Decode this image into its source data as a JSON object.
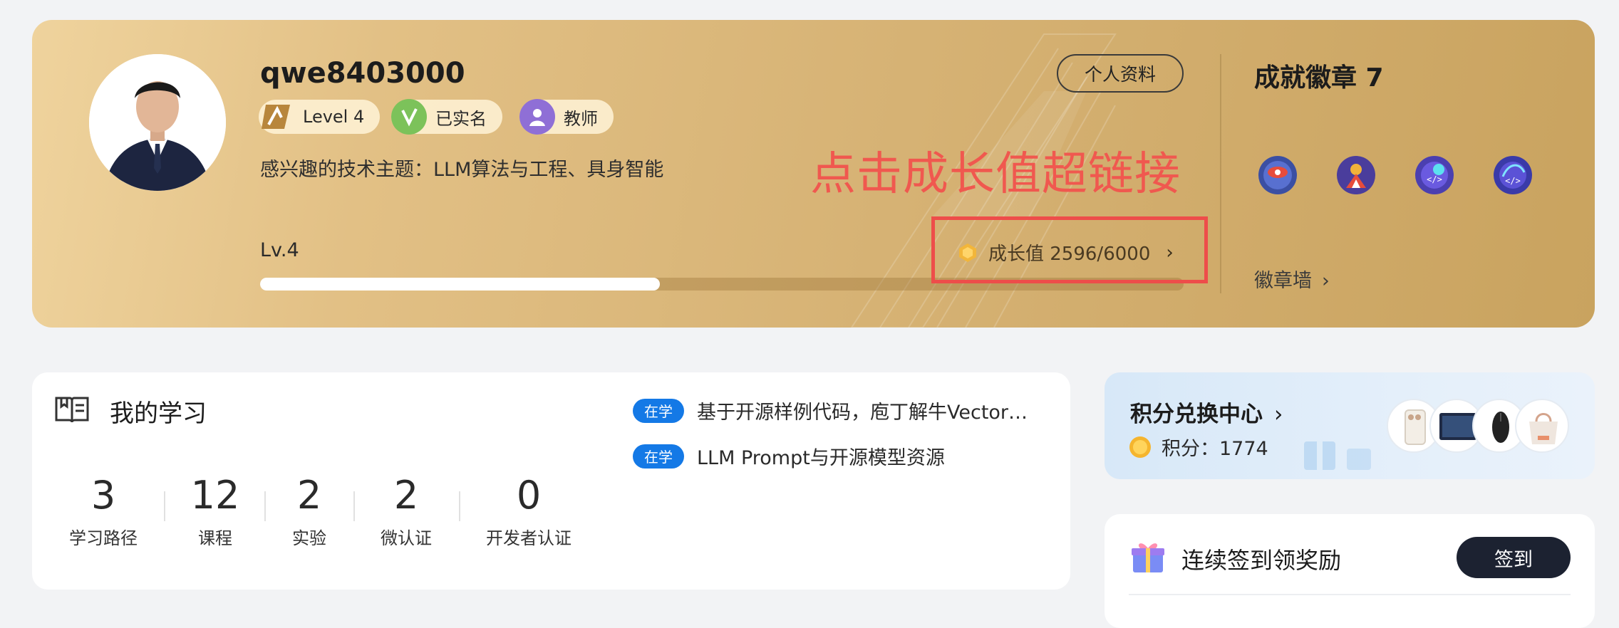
{
  "profile": {
    "username": "qwe8403000",
    "badges": [
      {
        "icon": "level-icon",
        "label": "Level 4"
      },
      {
        "icon": "verified-icon",
        "label": "已实名"
      },
      {
        "icon": "teacher-icon",
        "label": "教师"
      }
    ],
    "interests": "感兴趣的技术主题：LLM算法与工程、具身智能",
    "profile_button": "个人资料",
    "annotation": "点击成长值超链接",
    "level_label": "Lv.4",
    "growth_text": "成长值 2596/6000",
    "growth_progress": 0.4327,
    "achievements_title": "成就徽章 7",
    "achievement_badges": [
      "achievement-badge-eye-icon",
      "achievement-badge-figure-icon",
      "achievement-badge-code-icon",
      "achievement-badge-code-2-icon"
    ],
    "badge_wall_label": "徽章墙"
  },
  "learning": {
    "title": "我的学习",
    "stats": [
      {
        "value": "3",
        "label": "学习路径"
      },
      {
        "value": "12",
        "label": "课程"
      },
      {
        "value": "2",
        "label": "实验"
      },
      {
        "value": "2",
        "label": "微认证"
      },
      {
        "value": "0",
        "label": "开发者认证"
      }
    ],
    "courses": [
      {
        "tag": "在学",
        "title": "基于开源样例代码，庖丁解牛Vector…"
      },
      {
        "tag": "在学",
        "title": "LLM Prompt与开源模型资源"
      }
    ]
  },
  "points": {
    "title": "积分兑换中心",
    "points_text": "积分：1774",
    "prizes": [
      "phone-prize-icon",
      "tablet-prize-icon",
      "mouse-prize-icon",
      "tote-bag-prize-icon"
    ]
  },
  "signin": {
    "title": "连续签到领奖励",
    "button": "签到"
  },
  "colors": {
    "annotation": "#f0584f",
    "highlight_box": "#ee4d4a",
    "tag_blue": "#1479e6",
    "signin_button": "#1c2231"
  }
}
